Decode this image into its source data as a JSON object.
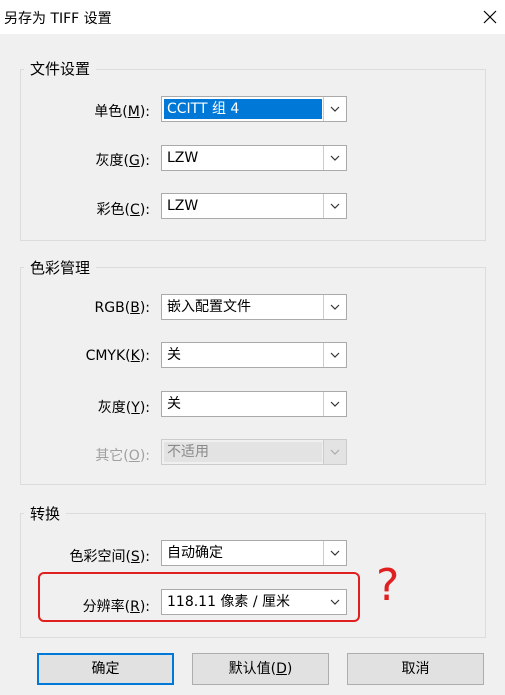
{
  "window": {
    "title": "另存为 TIFF 设置"
  },
  "file_settings": {
    "title": "文件设置",
    "mono": {
      "label": "单色(",
      "key": "M",
      "suffix": "):",
      "value": "CCITT 组 4"
    },
    "gray": {
      "label": "灰度(",
      "key": "G",
      "suffix": "):",
      "value": "LZW"
    },
    "color": {
      "label": "彩色(",
      "key": "C",
      "suffix": "):",
      "value": "LZW"
    }
  },
  "color_management": {
    "title": "色彩管理",
    "rgb": {
      "label": "RGB(",
      "key": "B",
      "suffix": "):",
      "value": "嵌入配置文件"
    },
    "cmyk": {
      "label": "CMYK(",
      "key": "K",
      "suffix": "):",
      "value": "关"
    },
    "gray": {
      "label": "灰度(",
      "key": "Y",
      "suffix": "):",
      "value": "关"
    },
    "other": {
      "label": "其它(",
      "key": "O",
      "suffix": "):",
      "value": "不适用"
    }
  },
  "conversion": {
    "title": "转换",
    "colorspace": {
      "label": "色彩空间(",
      "key": "S",
      "suffix": "):",
      "value": "自动确定"
    },
    "resolution": {
      "label": "分辨率(",
      "key": "R",
      "suffix": "):",
      "value": "118.11 像素 / 厘米"
    }
  },
  "annotation": {
    "mark": "?",
    "color": "#e02020"
  },
  "buttons": {
    "ok": "确定",
    "defaults": {
      "label": "默认值(",
      "key": "D",
      "suffix": ")"
    },
    "cancel": "取消"
  },
  "colors": {
    "selection": "#0078d7",
    "background": "#f0f0f0"
  }
}
